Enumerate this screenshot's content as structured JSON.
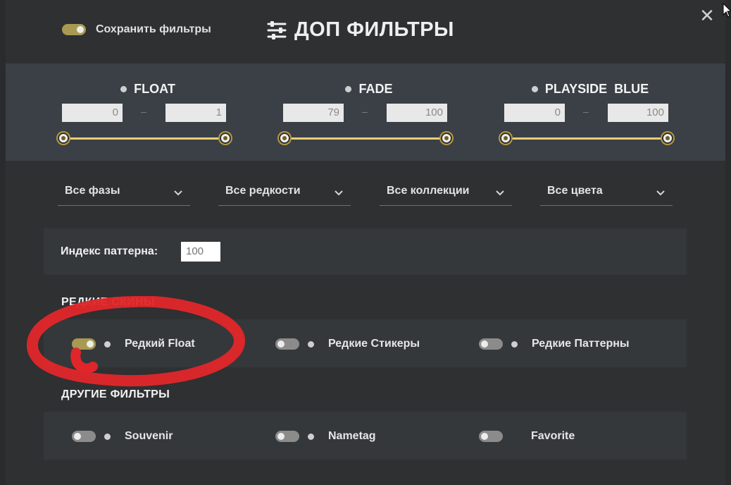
{
  "save_filters": {
    "label": "Сохранить фильтры",
    "enabled": true
  },
  "header": {
    "title": "ДОП ФИЛЬТРЫ",
    "icon": "sliders-icon"
  },
  "close": {
    "icon": "close-icon",
    "glyph": "✕"
  },
  "ranges": [
    {
      "label": "FLOAT",
      "min": "0",
      "max": "1"
    },
    {
      "label": "FADE",
      "min": "79",
      "max": "100"
    },
    {
      "label": "PLAYSIDE  BLUE",
      "min": "0",
      "max": "100"
    }
  ],
  "dropdowns": [
    {
      "label": "Все фазы"
    },
    {
      "label": "Все редкости"
    },
    {
      "label": "Все коллекции"
    },
    {
      "label": "Все цвета"
    }
  ],
  "pattern": {
    "label": "Индекс паттерна:",
    "placeholder": "100"
  },
  "rare_section": {
    "title": "РЕДКИЕ СКИНЫ",
    "options": [
      {
        "label": "Редкий Float",
        "enabled": true
      },
      {
        "label": "Редкие Стикеры",
        "enabled": false
      },
      {
        "label": "Редкие Паттерны",
        "enabled": false
      }
    ]
  },
  "other_section": {
    "title": "ДРУГИЕ ФИЛЬТРЫ",
    "options": [
      {
        "label": "Souvenir",
        "enabled": false
      },
      {
        "label": "Nametag",
        "enabled": false
      },
      {
        "label": "Favorite",
        "enabled": false
      }
    ]
  },
  "colors": {
    "accent": "#a89a53",
    "slider": "#e9cf76",
    "panel": "#35383b",
    "band": "#3b4046",
    "annotation": "#e0262a"
  }
}
